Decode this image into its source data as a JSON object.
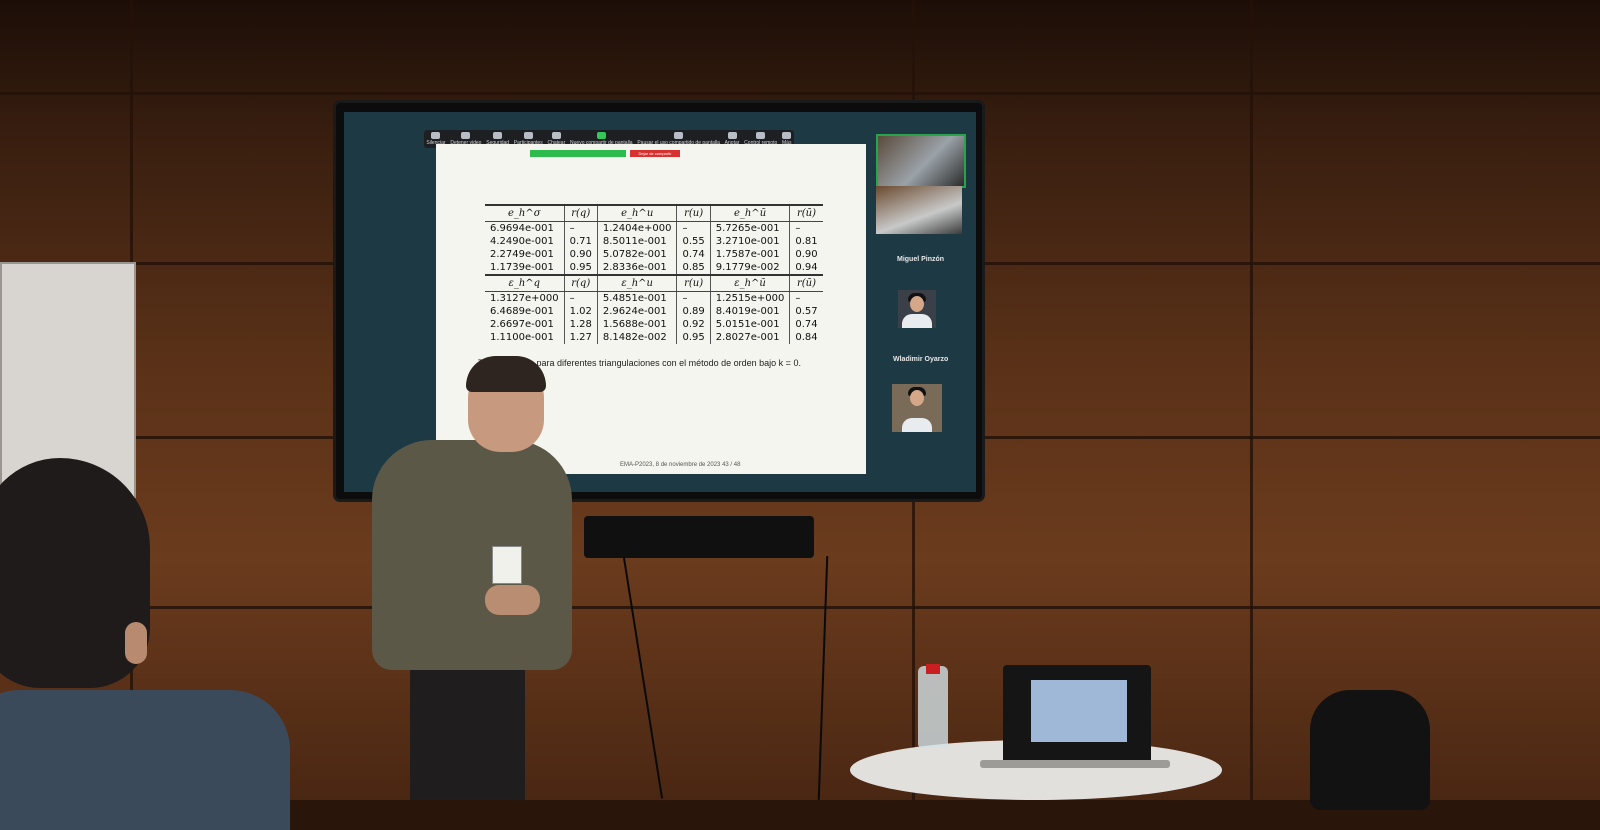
{
  "zoom_toolbar": {
    "items": [
      "Silenciar",
      "Detener video",
      "Seguridad",
      "Participantes",
      "Chatear",
      "Nuevo compartir de pantalla",
      "Pausar el uso compartido de pantalla",
      "Anotar",
      "Control remoto",
      "Más"
    ],
    "stop_share_label": "Dejar de compartir"
  },
  "slide": {
    "table_top": {
      "headers": [
        "e_h^σ",
        "r(q)",
        "e_h^u",
        "r(u)",
        "e_h^ũ",
        "r(ũ)"
      ],
      "rows": [
        [
          "6.9694e-001",
          "–",
          "1.2404e+000",
          "–",
          "5.7265e-001",
          "–"
        ],
        [
          "4.2490e-001",
          "0.71",
          "8.5011e-001",
          "0.55",
          "3.2710e-001",
          "0.81"
        ],
        [
          "2.2749e-001",
          "0.90",
          "5.0782e-001",
          "0.74",
          "1.7587e-001",
          "0.90"
        ],
        [
          "1.1739e-001",
          "0.95",
          "2.8336e-001",
          "0.85",
          "9.1779e-002",
          "0.94"
        ]
      ]
    },
    "table_bottom": {
      "headers": [
        "ε_h^q",
        "r(q)",
        "ε_h^u",
        "r(u)",
        "ε_h^ũ",
        "r(ũ)"
      ],
      "rows": [
        [
          "1.3127e+000",
          "–",
          "5.4851e-001",
          "–",
          "1.2515e+000",
          "–"
        ],
        [
          "6.4689e-001",
          "1.02",
          "2.9624e-001",
          "0.89",
          "8.4019e-001",
          "0.57"
        ],
        [
          "2.6697e-001",
          "1.28",
          "1.5688e-001",
          "0.92",
          "5.0151e-001",
          "0.74"
        ],
        [
          "1.1100e-001",
          "1.27",
          "8.1482e-002",
          "0.95",
          "2.8027e-001",
          "0.84"
        ]
      ]
    },
    "caption": "Table: Errores para diferentes triangulaciones con el método de orden bajo k = 0.",
    "footer": "EMA-P2023, 8 de noviembre de 2023     43 / 48"
  },
  "participants": [
    "Miguel Pinzón",
    "Wladimir Oyarzo"
  ],
  "colors": {
    "slide_bg": "#f4f5ee",
    "zoom_green": "#2aa44a",
    "stop_red": "#d93030",
    "wall_wood": "#6b3b1d"
  }
}
